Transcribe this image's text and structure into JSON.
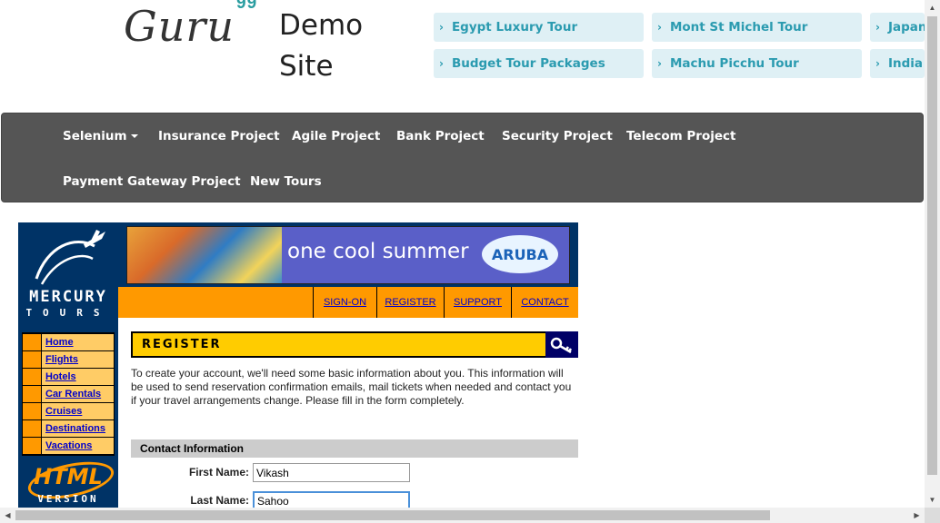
{
  "header": {
    "logo_text": "Guru",
    "logo_sup": "99",
    "site_title": "Demo Site",
    "tour_links": [
      "Egypt Luxury Tour",
      "Mont St Michel Tour",
      "Japan",
      "Budget Tour Packages",
      "Machu Picchu Tour",
      "India"
    ]
  },
  "navbar": {
    "items": [
      "Selenium",
      "Insurance Project",
      "Agile Project",
      "Bank Project",
      "Security Project",
      "Telecom Project",
      "Payment Gateway Project",
      "New Tours"
    ]
  },
  "mercury": {
    "logo_line1": "MERCURY",
    "logo_line2": "TOURS",
    "menu": [
      "Home",
      "Flights",
      "Hotels",
      "Car Rentals",
      "Cruises",
      "Destinations",
      "Vacations"
    ],
    "html_badge_line1": "HTML",
    "html_badge_line2": "VERSION",
    "banner_text": "one cool summer",
    "banner_brand": "ARUBA",
    "top_links": [
      "SIGN-ON",
      "REGISTER",
      "SUPPORT",
      "CONTACT"
    ]
  },
  "register": {
    "title": "REGISTER",
    "intro": "To create your account, we'll need some basic information about you. This information will be used to send reservation confirmation emails, mail tickets when needed and contact you if your travel arrangements change. Please fill in the form completely.",
    "section_header": "Contact Information",
    "first_name_label": "First Name:",
    "first_name_value": "Vikash",
    "last_name_label": "Last Name:",
    "last_name_value": "Sahoo"
  },
  "colors": {
    "navbar_bg": "#555555",
    "tour_btn_bg": "#dff0f5",
    "tour_btn_text": "#2b9bb0",
    "mercury_blue": "#003366",
    "mercury_orange": "#ff9900",
    "register_yellow": "#ffcc00"
  }
}
